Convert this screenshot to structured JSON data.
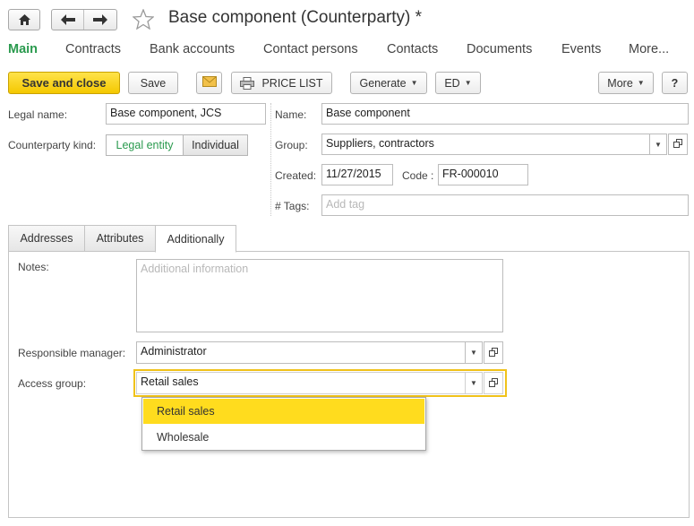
{
  "window": {
    "title": "Base component (Counterparty) *"
  },
  "nav": {
    "home_icon": "home-icon",
    "back_icon": "arrow-left-icon",
    "forward_icon": "arrow-right-icon",
    "favorite_icon": "star-icon"
  },
  "section_tabs": [
    {
      "label": "Main",
      "active": true
    },
    {
      "label": "Contracts"
    },
    {
      "label": "Bank accounts"
    },
    {
      "label": "Contact persons"
    },
    {
      "label": "Contacts"
    },
    {
      "label": "Documents"
    },
    {
      "label": "Events"
    },
    {
      "label": "More..."
    }
  ],
  "toolbar": {
    "save_and_close": "Save and close",
    "save": "Save",
    "price_list": "PRICE LIST",
    "generate": "Generate",
    "ed": "ED",
    "more": "More",
    "help": "?"
  },
  "form": {
    "legal_name_label": "Legal name:",
    "legal_name_value": "Base component, JCS",
    "kind_label": "Counterparty kind:",
    "kind_legal": "Legal entity",
    "kind_individual": "Individual",
    "name_label": "Name:",
    "name_value": "Base component",
    "group_label": "Group:",
    "group_value": "Suppliers, contractors",
    "created_label": "Created:",
    "created_value": "11/27/2015",
    "code_label": "Code :",
    "code_value": "FR-000010",
    "tags_label": "# Tags:",
    "tags_placeholder": "Add tag"
  },
  "panel_tabs": [
    {
      "label": "Addresses"
    },
    {
      "label": "Attributes"
    },
    {
      "label": "Additionally",
      "active": true
    }
  ],
  "additionally": {
    "notes_label": "Notes:",
    "notes_placeholder": "Additional information",
    "manager_label": "Responsible manager:",
    "manager_value": "Administrator",
    "access_label": "Access group:",
    "access_value": "Retail sales"
  },
  "access_dropdown": {
    "options": [
      "Retail sales",
      "Wholesale"
    ],
    "selected": "Retail sales"
  },
  "colors": {
    "accent_green": "#2a9a4e",
    "primary_yellow": "#f4c800",
    "focus_yellow": "#f0c21a",
    "selection_yellow": "#ffdc1e"
  }
}
